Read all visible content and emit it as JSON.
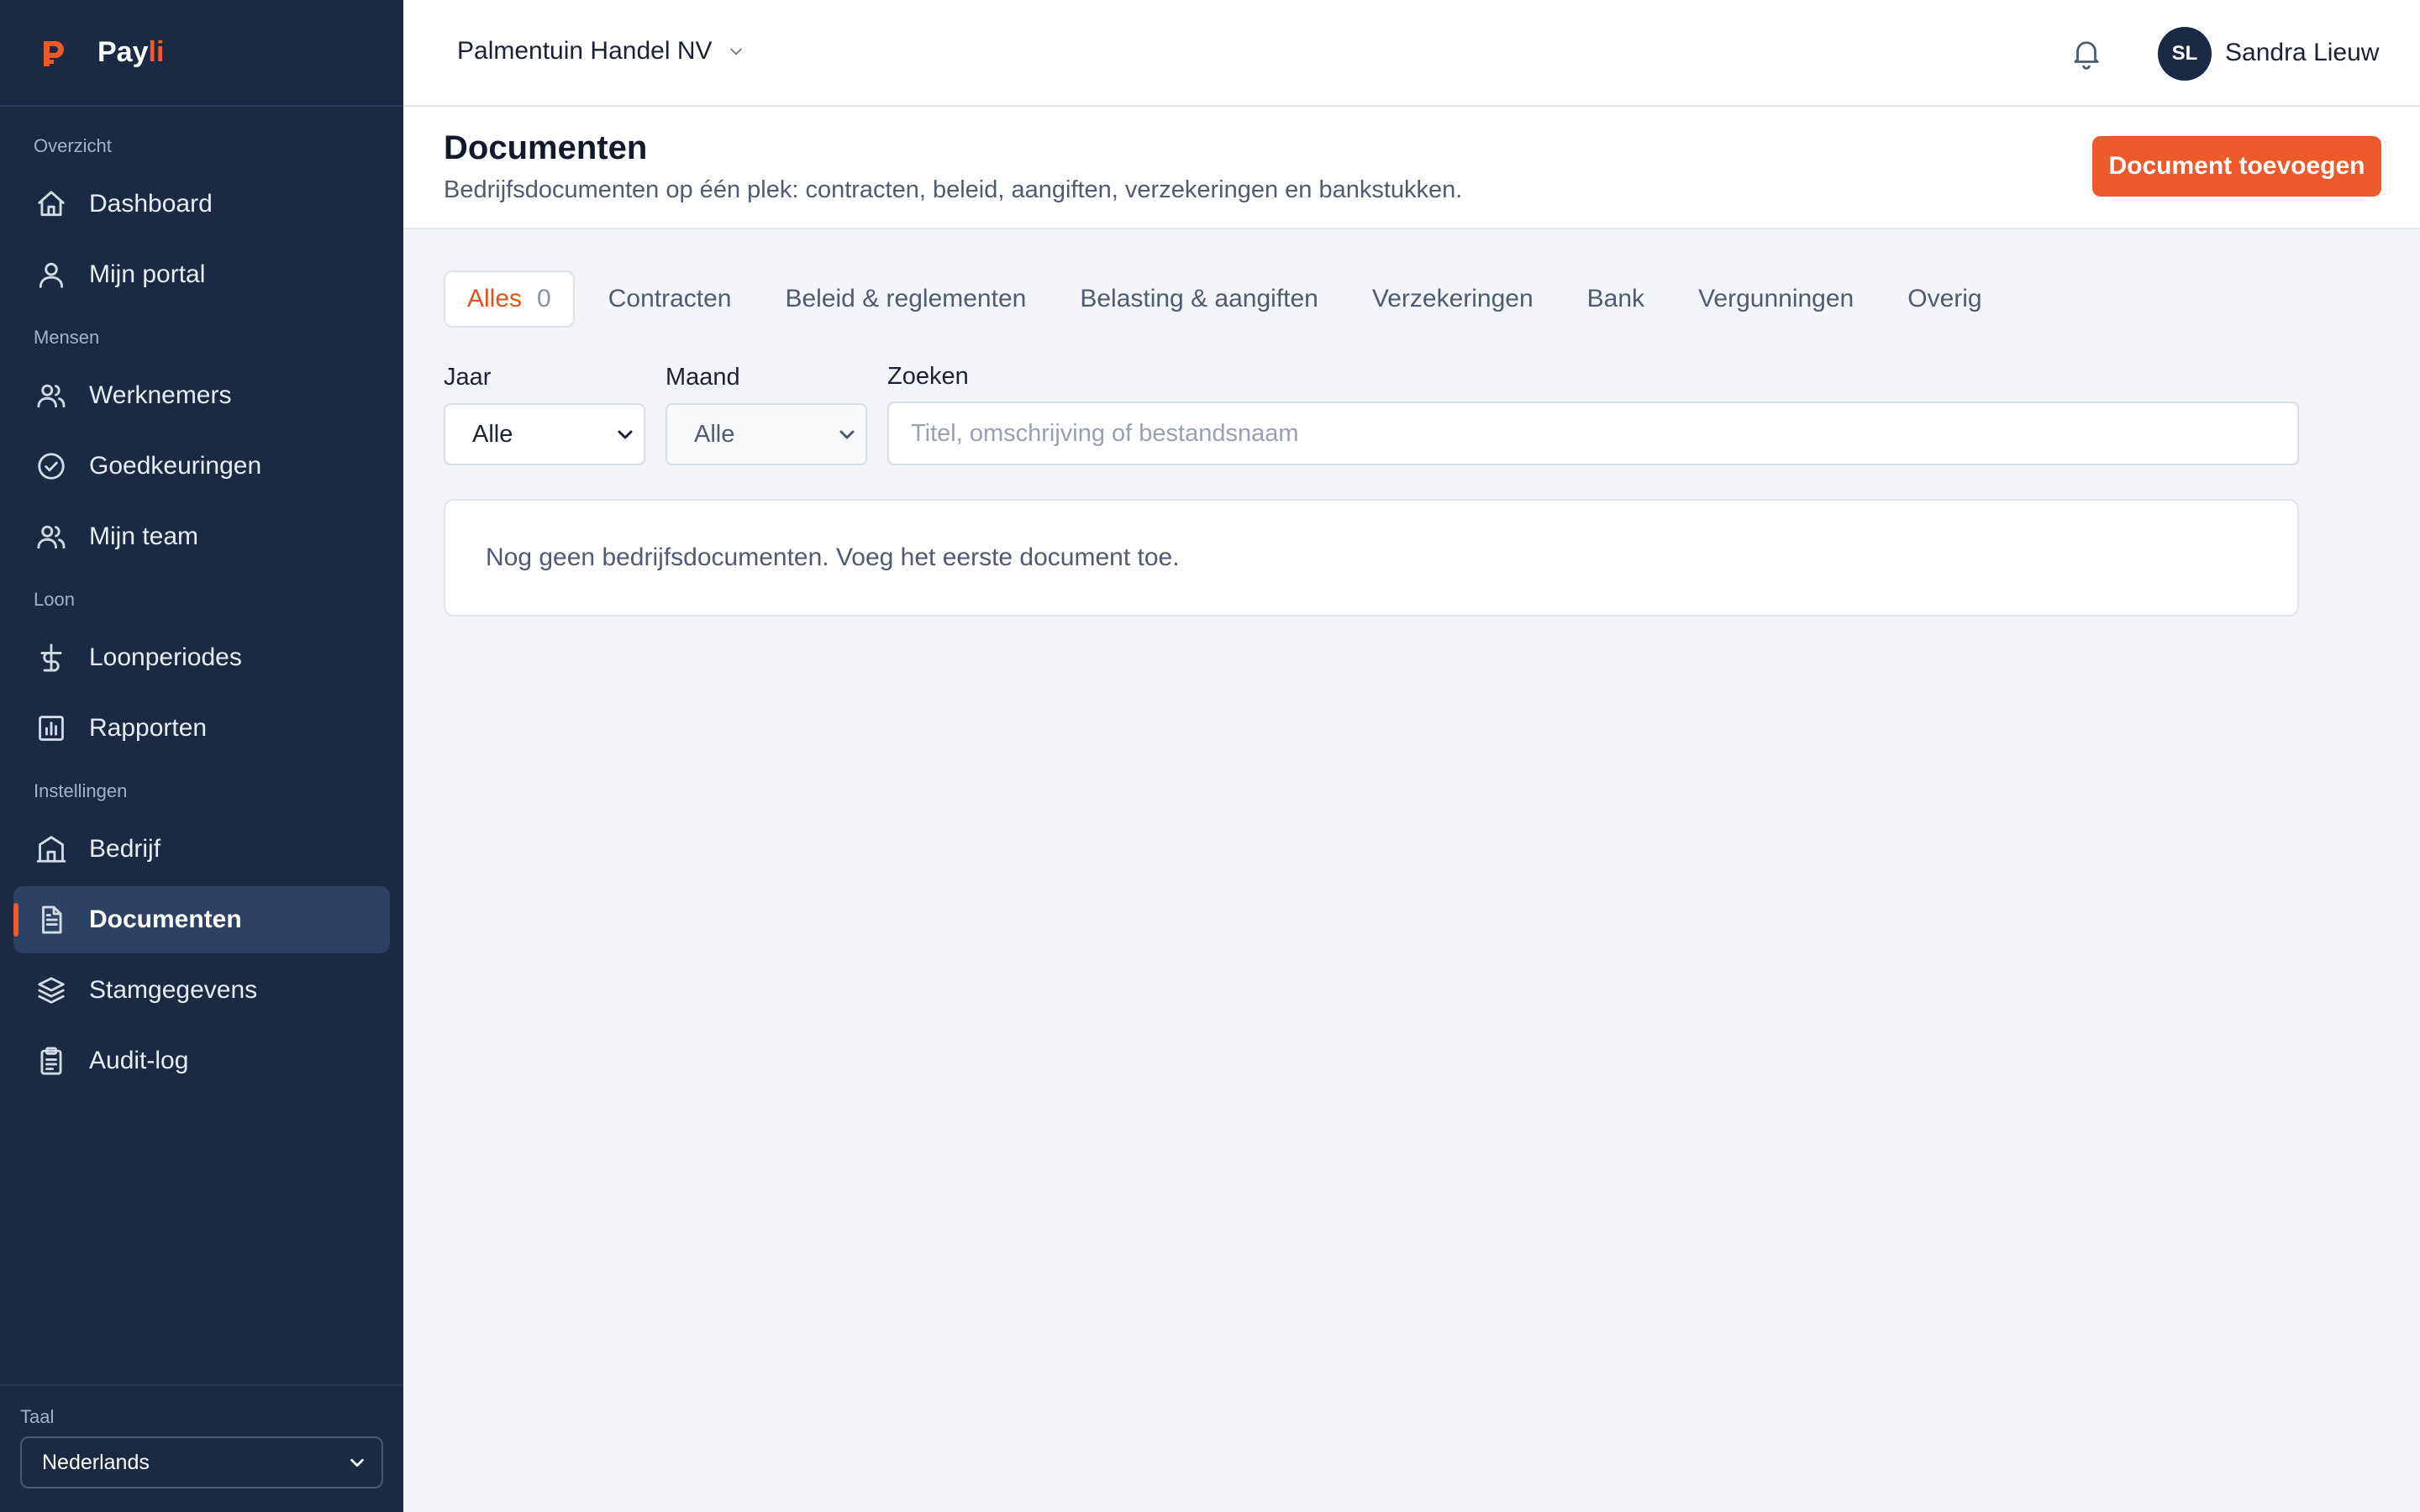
{
  "brand": {
    "name_main": "Pay",
    "name_accent": "li"
  },
  "sidebar": {
    "sections": [
      {
        "label": "Overzicht",
        "items": [
          {
            "label": "Dashboard",
            "icon": "home-icon"
          },
          {
            "label": "Mijn portal",
            "icon": "user-icon"
          }
        ]
      },
      {
        "label": "Mensen",
        "items": [
          {
            "label": "Werknemers",
            "icon": "users-icon"
          },
          {
            "label": "Goedkeuringen",
            "icon": "check-circle-icon"
          },
          {
            "label": "Mijn team",
            "icon": "users-icon"
          }
        ]
      },
      {
        "label": "Loon",
        "items": [
          {
            "label": "Loonperiodes",
            "icon": "currency-icon"
          },
          {
            "label": "Rapporten",
            "icon": "bar-chart-icon"
          }
        ]
      },
      {
        "label": "Instellingen",
        "items": [
          {
            "label": "Bedrijf",
            "icon": "building-icon"
          },
          {
            "label": "Documenten",
            "icon": "document-icon",
            "active": true
          },
          {
            "label": "Stamgegevens",
            "icon": "layers-icon"
          },
          {
            "label": "Audit-log",
            "icon": "clipboard-icon"
          }
        ]
      }
    ],
    "footer": {
      "label": "Taal",
      "language": "Nederlands"
    }
  },
  "topbar": {
    "organization": "Palmentuin Handel NV",
    "user_initials": "SL",
    "user_name": "Sandra Lieuw"
  },
  "header": {
    "title": "Documenten",
    "subtitle": "Bedrijfsdocumenten op één plek: contracten, beleid, aangiften, verzekeringen en bankstukken.",
    "add_button": "Document toevoegen"
  },
  "tabs": [
    {
      "label": "Alles",
      "count": "0",
      "active": true
    },
    {
      "label": "Contracten"
    },
    {
      "label": "Beleid & reglementen"
    },
    {
      "label": "Belasting & aangiften"
    },
    {
      "label": "Verzekeringen"
    },
    {
      "label": "Bank"
    },
    {
      "label": "Vergunningen"
    },
    {
      "label": "Overig"
    }
  ],
  "filters": {
    "year_label": "Jaar",
    "year_value": "Alle",
    "month_label": "Maand",
    "month_value": "Alle",
    "search_label": "Zoeken",
    "search_placeholder": "Titel, omschrijving of bestandsnaam"
  },
  "empty_state": "Nog geen bedrijfsdocumenten. Voeg het eerste document toe.",
  "colors": {
    "sidebar_bg": "#1b2944",
    "accent": "#ec5a2b",
    "active_item_bg": "#2c4265"
  }
}
